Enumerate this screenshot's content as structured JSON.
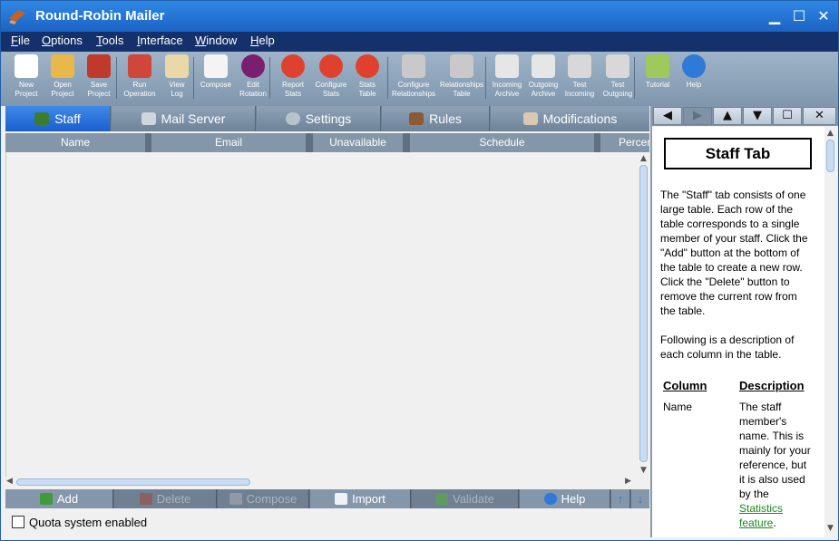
{
  "window": {
    "title": "Round-Robin Mailer"
  },
  "menu": [
    "File",
    "Options",
    "Tools",
    "Interface",
    "Window",
    "Help"
  ],
  "toolbar": [
    {
      "label": "New\nProject",
      "icon": "new-project-icon",
      "color": "#ffffff"
    },
    {
      "label": "Open\nProject",
      "icon": "open-project-icon",
      "color": "#e8b84a"
    },
    {
      "label": "Save\nProject",
      "icon": "save-project-icon",
      "color": "#c0392b"
    },
    {
      "label": "Run\nOperation",
      "icon": "run-operation-icon",
      "color": "#d0463a"
    },
    {
      "label": "View\nLog",
      "icon": "view-log-icon",
      "color": "#e9d9a8"
    },
    {
      "label": "Compose",
      "icon": "compose-icon",
      "color": "#f4f4f4"
    },
    {
      "label": "Edit\nRotation",
      "icon": "edit-rotation-icon",
      "color": "#7a1f6e"
    },
    {
      "label": "Report\nStats",
      "icon": "report-stats-icon",
      "color": "#e0412f"
    },
    {
      "label": "Configure\nStats",
      "icon": "configure-stats-icon",
      "color": "#e0412f"
    },
    {
      "label": "Stats\nTable",
      "icon": "stats-table-icon",
      "color": "#e0412f"
    },
    {
      "label": "Configure\nRelationships",
      "icon": "configure-relationships-icon",
      "color": "#c9c9c9"
    },
    {
      "label": "Relationships\nTable",
      "icon": "relationships-table-icon",
      "color": "#c9c9c9"
    },
    {
      "label": "Incoming\nArchive",
      "icon": "incoming-archive-icon",
      "color": "#e6e6e6"
    },
    {
      "label": "Outgoing\nArchive",
      "icon": "outgoing-archive-icon",
      "color": "#e6e6e6"
    },
    {
      "label": "Test\nIncoming",
      "icon": "test-incoming-icon",
      "color": "#d8d8d8"
    },
    {
      "label": "Test\nOutgoing",
      "icon": "test-outgoing-icon",
      "color": "#d8d8d8"
    },
    {
      "label": "Tutorial",
      "icon": "tutorial-icon",
      "color": "#9fc95b"
    },
    {
      "label": "Help",
      "icon": "help-icon",
      "color": "#2f7ad8"
    }
  ],
  "tabs": [
    {
      "label": "Staff",
      "icon": "staff-icon",
      "active": true
    },
    {
      "label": "Mail Server",
      "icon": "mail-server-icon"
    },
    {
      "label": "Settings",
      "icon": "settings-gear-icon"
    },
    {
      "label": "Rules",
      "icon": "rules-gavel-icon"
    },
    {
      "label": "Modifications",
      "icon": "modifications-icon"
    }
  ],
  "columns": [
    "Name",
    "Email",
    "Unavailable",
    "Schedule",
    "Percen"
  ],
  "buttons": [
    {
      "label": "Add",
      "icon": "add-icon",
      "enabled": true
    },
    {
      "label": "Delete",
      "icon": "delete-icon",
      "enabled": false
    },
    {
      "label": "Compose",
      "icon": "compose-icon",
      "enabled": false
    },
    {
      "label": "Import",
      "icon": "import-icon",
      "enabled": true
    },
    {
      "label": "Validate",
      "icon": "validate-icon",
      "enabled": false
    },
    {
      "label": "Help",
      "icon": "help-icon",
      "enabled": true
    }
  ],
  "quota": {
    "label": "Quota system enabled",
    "checked": false
  },
  "help": {
    "heading": "Staff Tab",
    "lines1": [
      "The \"Staff\" tab consists of one",
      "large table.  Each row of the",
      "table corresponds to a single",
      "member of your staff.  Click the",
      "\"Add\" button at the bottom of",
      "the table to create a new row.",
      "Click the \"Delete\" button to",
      "remove the current row from",
      "the table."
    ],
    "lines2": [
      "Following is a description of",
      "each column in the table."
    ],
    "col_head": "Column",
    "desc_head": "Description",
    "row_name": "Name",
    "desc_lines": [
      "The staff",
      "member's",
      "name.  This is",
      "mainly for your",
      "reference, but",
      "it is also used",
      "by the"
    ],
    "link_lines": [
      "Statistics",
      "feature"
    ],
    "link_tail": "."
  }
}
